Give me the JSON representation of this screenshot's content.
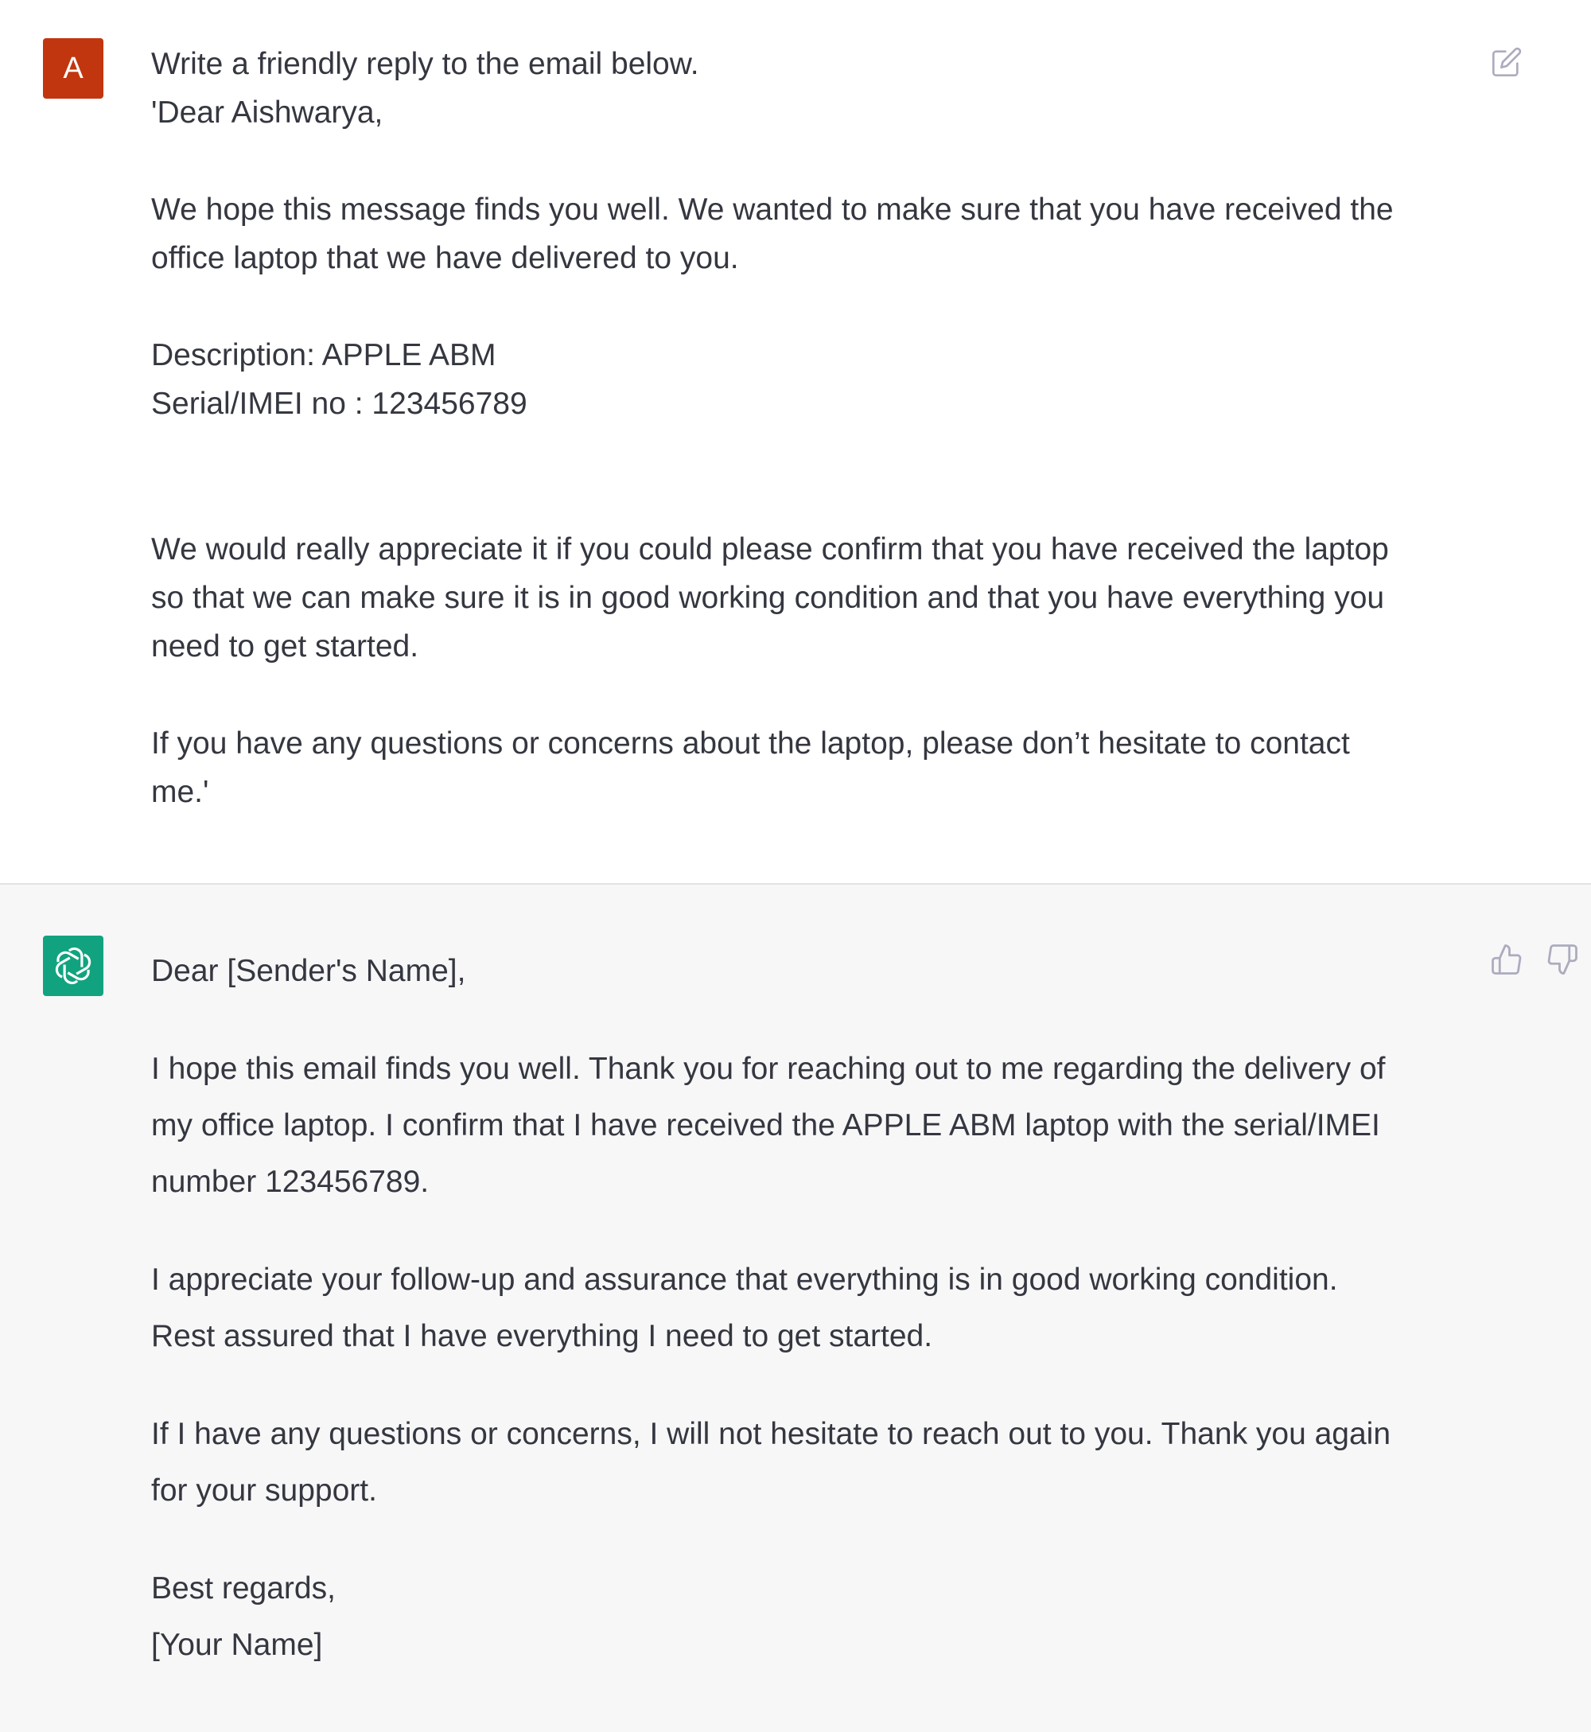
{
  "user_message": {
    "avatar_letter": "A",
    "avatar_color": "#c1360f",
    "lines": {
      "l1": "Write a friendly reply to the email below.",
      "l2": "'Dear Aishwarya,",
      "l3": "We hope this message finds you well. We wanted to make sure that you have received the",
      "l4": "office laptop that we have delivered to you.",
      "l5": "Description: APPLE ABM",
      "l6": "Serial/IMEI no : 123456789",
      "l7": "We would really appreciate it if you could please confirm that you have received the laptop",
      "l8": "so that we can make sure it is in good working condition and that you have everything you",
      "l9": "need to get started.",
      "l10": "If you have any questions or concerns about the laptop, please don’t hesitate to contact",
      "l11": "me.'"
    },
    "edit_icon": "edit-icon"
  },
  "assistant_message": {
    "avatar_icon": "openai-logo-icon",
    "avatar_color": "#11a37f",
    "lines": {
      "greeting": "Dear [Sender's Name],",
      "p1a": "I hope this email finds you well. Thank you for reaching out to me regarding the delivery of",
      "p1b": "my office laptop. I confirm that I have received the APPLE ABM laptop with the serial/IMEI",
      "p1c": "number 123456789.",
      "p2a": "I appreciate your follow-up and assurance that everything is in good working condition.",
      "p2b": "Rest assured that I have everything I need to get started.",
      "p3a": "If I have any questions or concerns, I will not hesitate to reach out to you. Thank you again",
      "p3b": "for your support.",
      "closing": "Best regards,",
      "signature": "[Your Name]"
    },
    "feedback_icons": [
      "thumbs-up-icon",
      "thumbs-down-icon"
    ]
  },
  "colors": {
    "text": "#353740",
    "assistant_bg": "#f7f7f8",
    "icon": "#acacbe"
  }
}
